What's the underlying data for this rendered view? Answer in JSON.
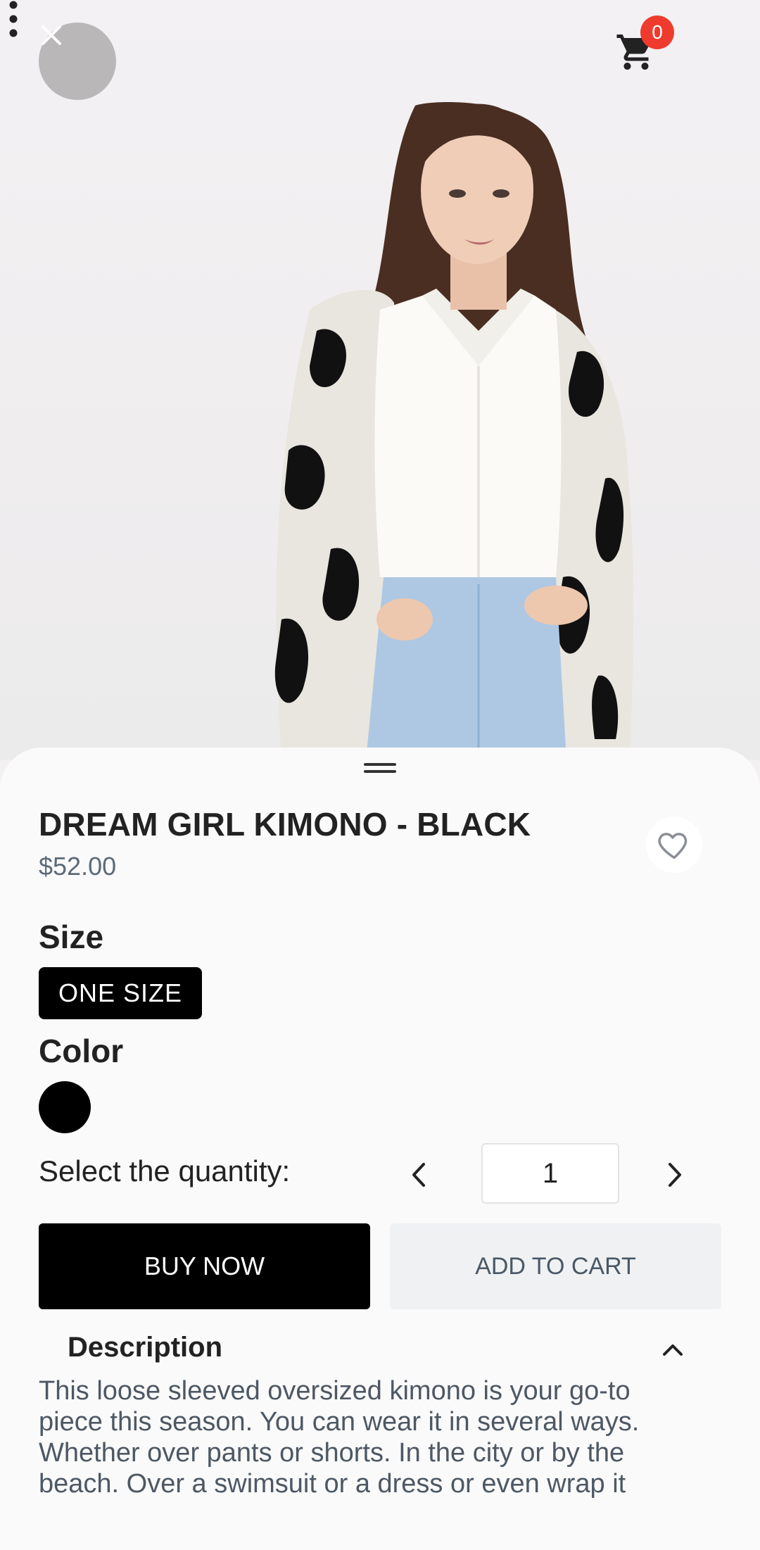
{
  "header": {
    "close_icon": "close-icon",
    "cart_icon": "cart-icon",
    "cart_count": "0",
    "more_icon": "more-vertical-icon"
  },
  "product": {
    "title": "DREAM GIRL KIMONO - BLACK",
    "price": "$52.00",
    "favorite_icon": "heart-outline-icon"
  },
  "size": {
    "label": "Size",
    "selected": "ONE SIZE"
  },
  "color": {
    "label": "Color",
    "swatch": "#000000"
  },
  "quantity": {
    "label": "Select the quantity:",
    "value": "1"
  },
  "actions": {
    "buy_now": "BUY NOW",
    "add_to_cart": "ADD TO CART"
  },
  "description": {
    "label": "Description",
    "text": "This loose sleeved oversized kimono is your go-to piece this season. You can wear it in several ways. Whether over pants or shorts. In the city or by the beach. Over a swimsuit or a dress or even wrap it"
  },
  "colors": {
    "badge": "#ee3b2e",
    "primary_button": "#000000",
    "secondary_button": "#eff1f3",
    "price_text": "#5c6b78"
  }
}
